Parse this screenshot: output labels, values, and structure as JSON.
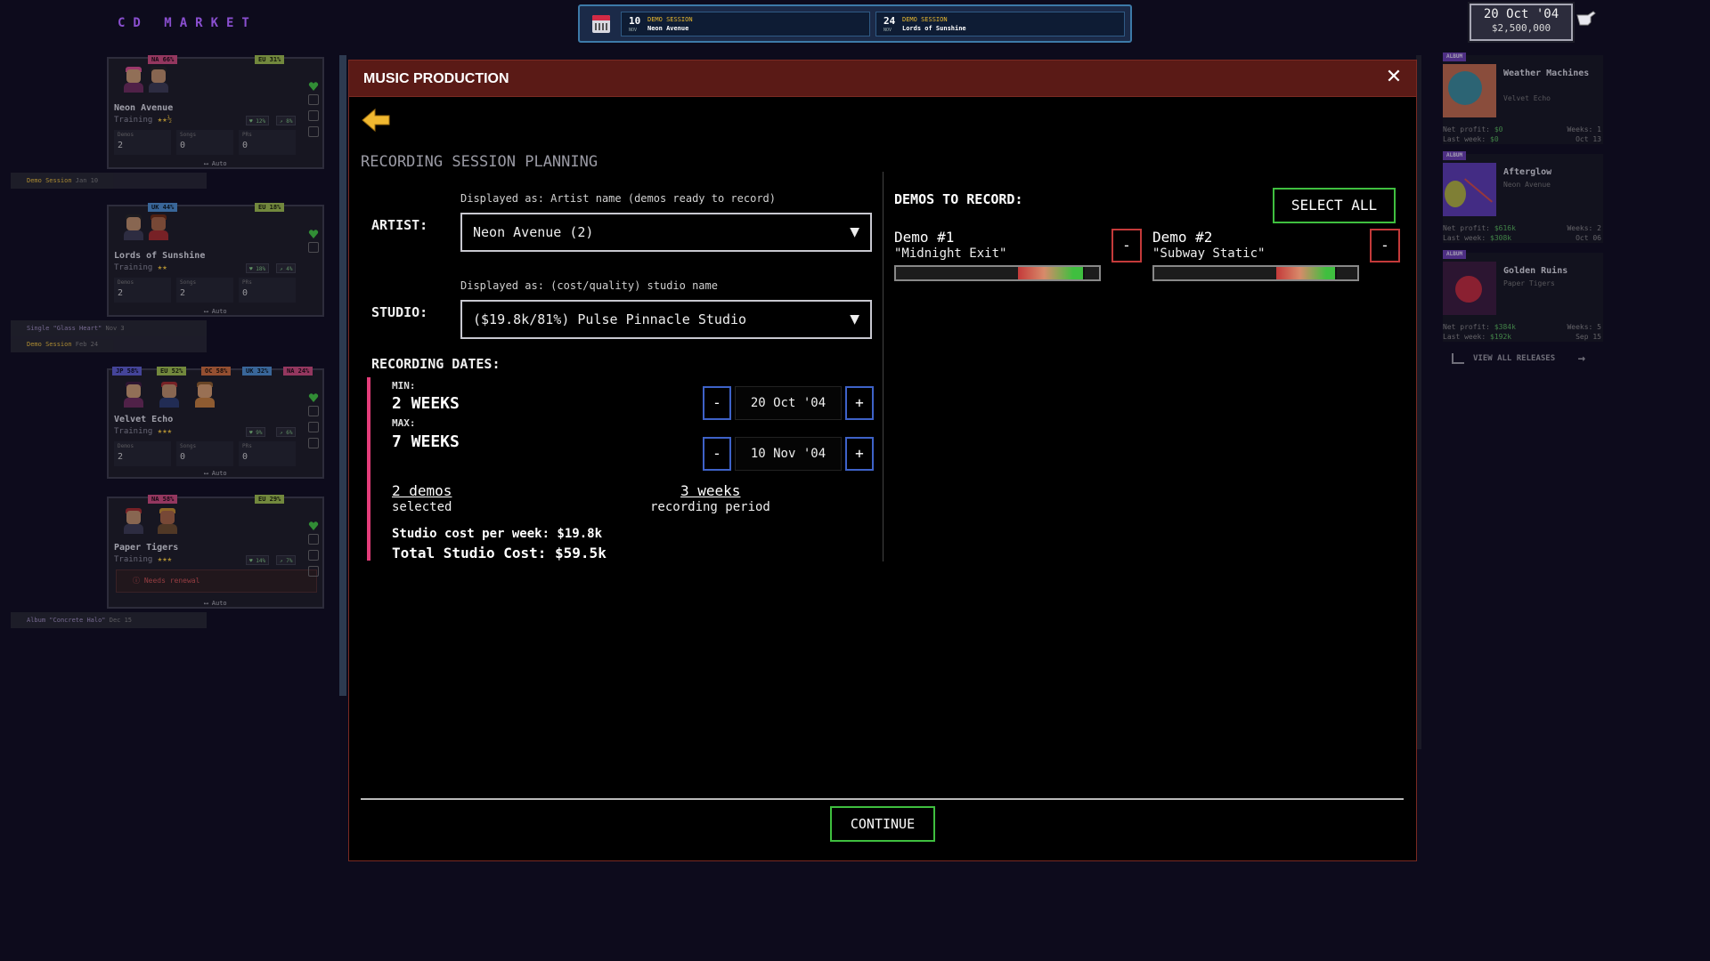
{
  "app": {
    "logo": "CD MARKET"
  },
  "schedule": [
    {
      "day": "10",
      "month": "NOV",
      "type": "DEMO SESSION",
      "name": "Neon Avenue"
    },
    {
      "day": "24",
      "month": "NOV",
      "type": "DEMO SESSION",
      "name": "Lords of Sunshine"
    }
  ],
  "status": {
    "date": "20 Oct '04",
    "money": "$2,500,000"
  },
  "artists": [
    {
      "name": "Neon Avenue",
      "training": "Training",
      "stars": "★★½",
      "flags": [
        {
          "label": "NA 66%",
          "color": "#c9487a"
        },
        {
          "label": "EU 31%",
          "color": "#9ab84a"
        }
      ],
      "pct_a": "♥ 12%",
      "pct_b": "↗ 8%",
      "stat_labels": [
        "Demos",
        "Songs",
        "PRs"
      ],
      "stats": [
        "2",
        "0",
        "0"
      ],
      "auto": "⟷ Auto",
      "subs": [
        {
          "type": "Demo Session",
          "date": "Jan 10",
          "name": ""
        }
      ]
    },
    {
      "name": "Lords of Sunshine",
      "training": "Training",
      "stars": "★★",
      "flags": [
        {
          "label": "UK 44%",
          "color": "#4a8ac9"
        },
        {
          "label": "EU 18%",
          "color": "#9ab84a"
        }
      ],
      "pct_a": "♥ 18%",
      "pct_b": "↗ 4%",
      "stat_labels": [
        "Demos",
        "Songs",
        "PRs"
      ],
      "stats": [
        "2",
        "2",
        "0"
      ],
      "auto": "⟷ Auto",
      "subs": [
        {
          "type": "Single",
          "name": "\"Glass Heart\"",
          "date": "Nov 3"
        },
        {
          "type": "Demo Session",
          "name": "",
          "date": "Feb 24"
        }
      ]
    },
    {
      "name": "Velvet Echo",
      "training": "Training",
      "stars": "★★★",
      "flags": [
        {
          "label": "JP 58%",
          "color": "#5a5ac9"
        },
        {
          "label": "EU 52%",
          "color": "#9ab84a"
        },
        {
          "label": "OC 58%",
          "color": "#c96a3a"
        },
        {
          "label": "UK 32%",
          "color": "#4a8ac9"
        },
        {
          "label": "NA 24%",
          "color": "#c9487a"
        }
      ],
      "pct_a": "♥ 9%",
      "pct_b": "↗ 6%",
      "stat_labels": [
        "Demos",
        "Songs",
        "PRs"
      ],
      "stats": [
        "2",
        "0",
        "0"
      ],
      "auto": "⟷ Auto",
      "subs": []
    },
    {
      "name": "Paper Tigers",
      "training": "Training",
      "stars": "★★★",
      "flags": [
        {
          "label": "NA 58%",
          "color": "#c9487a"
        },
        {
          "label": "EU 29%",
          "color": "#9ab84a"
        }
      ],
      "pct_a": "♥ 14%",
      "pct_b": "↗ 7%",
      "warning": "ⓘ Needs renewal",
      "auto": "⟷ Auto",
      "subs": [
        {
          "type": "Album",
          "name": "\"Concrete Halo\"",
          "date": "Dec 15"
        }
      ]
    }
  ],
  "releases": [
    {
      "tag": "ALBUM",
      "title": "Weather Machines",
      "artist": "Velvet Echo",
      "net_profit_label": "Net profit:",
      "net_profit": "$0",
      "last_week_label": "Last week:",
      "last_week": "$0",
      "weeks": "Weeks: 1",
      "date": "Oct 13"
    },
    {
      "tag": "ALBUM",
      "title": "Afterglow",
      "artist": "Neon Avenue",
      "net_profit_label": "Net profit:",
      "net_profit": "$616k",
      "last_week_label": "Last week:",
      "last_week": "$308k",
      "weeks": "Weeks: 2",
      "date": "Oct 06"
    },
    {
      "tag": "ALBUM",
      "title": "Golden Ruins",
      "artist": "Paper Tigers",
      "net_profit_label": "Net profit:",
      "net_profit": "$384k",
      "last_week_label": "Last week:",
      "last_week": "$192k",
      "weeks": "Weeks: 5",
      "date": "Sep 15"
    }
  ],
  "view_all": "VIEW ALL RELEASES",
  "modal": {
    "title": "MUSIC PRODUCTION",
    "close": "✕",
    "section_title": "RECORDING SESSION PLANNING",
    "artist_label": "ARTIST:",
    "artist_hint": "Displayed as: Artist name (demos ready to record)",
    "artist_value": "Neon Avenue (2)",
    "studio_label": "STUDIO:",
    "studio_hint": "Displayed as: (cost/quality) studio name",
    "studio_value": "($19.8k/81%) Pulse Pinnacle Studio",
    "dates_label": "RECORDING DATES:",
    "min_label": "MIN:",
    "min_weeks": "2 WEEKS",
    "min_date": "20 Oct '04",
    "max_label": "MAX:",
    "max_weeks": "7 WEEKS",
    "max_date": "10 Nov '04",
    "minus": "-",
    "plus": "+",
    "demos_selected": "2 demos",
    "demos_selected_sub": "selected",
    "period": "3 weeks",
    "period_sub": "recording period",
    "cost_per_week": "Studio cost per week: $19.8k",
    "total_cost": "Total Studio Cost: $59.5k",
    "demos_title": "DEMOS TO RECORD:",
    "select_all": "SELECT ALL",
    "demos": [
      {
        "name": "Demo #1",
        "song": "\"Midnight Exit\"",
        "quality": 0.8,
        "potential": 0.92
      },
      {
        "name": "Demo #2",
        "song": "\"Subway Static\"",
        "quality": 0.8,
        "potential": 0.89
      }
    ],
    "remove": "-",
    "continue": "CONTINUE"
  }
}
